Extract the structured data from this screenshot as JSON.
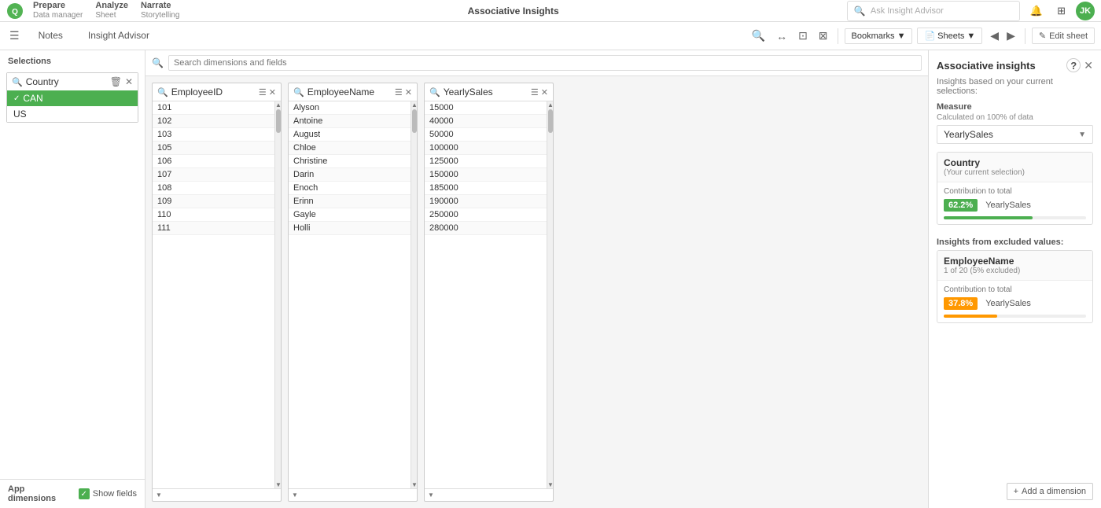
{
  "app": {
    "title": "Associative Insights",
    "tabs": [
      {
        "id": "notes",
        "label": "Notes",
        "active": false
      },
      {
        "id": "insight_advisor",
        "label": "Insight Advisor",
        "active": false
      }
    ],
    "insight_advisor_placeholder": "Ask Insight Advisor",
    "edit_sheet_label": "Edit sheet"
  },
  "toolbar": {
    "bookmarks_label": "Bookmarks",
    "sheets_label": "Sheets"
  },
  "prepare": {
    "label": "Prepare",
    "sub": "Data manager"
  },
  "analyze": {
    "label": "Analyze",
    "sub": "Sheet"
  },
  "narrate": {
    "label": "Narrate",
    "sub": "Storytelling"
  },
  "selections": {
    "header": "Selections",
    "fields": [
      {
        "id": "country",
        "title": "Country",
        "items": [
          {
            "value": "CAN",
            "state": "selected"
          },
          {
            "value": "US",
            "state": "available"
          }
        ]
      }
    ]
  },
  "app_dimensions": {
    "label": "App dimensions",
    "show_fields": "Show fields",
    "show_fields_checked": true,
    "search_placeholder": "Search dimensions and fields",
    "tables": [
      {
        "id": "employee_id",
        "title": "EmployeeID",
        "rows": [
          {
            "value": "101"
          },
          {
            "value": "102"
          },
          {
            "value": "103"
          },
          {
            "value": "105"
          },
          {
            "value": "106"
          },
          {
            "value": "107"
          },
          {
            "value": "108"
          },
          {
            "value": "109"
          },
          {
            "value": "110"
          },
          {
            "value": "111"
          }
        ]
      },
      {
        "id": "employee_name",
        "title": "EmployeeName",
        "rows": [
          {
            "value": "Alyson"
          },
          {
            "value": "Antoine"
          },
          {
            "value": "August"
          },
          {
            "value": "Chloe"
          },
          {
            "value": "Christine"
          },
          {
            "value": "Darin"
          },
          {
            "value": "Enoch"
          },
          {
            "value": "Erinn"
          },
          {
            "value": "Gayle"
          },
          {
            "value": "Holli"
          }
        ]
      },
      {
        "id": "yearly_sales",
        "title": "YearlySales",
        "rows": [
          {
            "value": "15000"
          },
          {
            "value": "40000"
          },
          {
            "value": "50000"
          },
          {
            "value": "100000"
          },
          {
            "value": "125000"
          },
          {
            "value": "150000"
          },
          {
            "value": "185000"
          },
          {
            "value": "190000"
          },
          {
            "value": "250000"
          },
          {
            "value": "280000"
          }
        ]
      }
    ]
  },
  "associative_insights": {
    "panel_title": "Associative insights",
    "help_tooltip": "Help",
    "insights_subtitle": "Insights based on your current selections:",
    "measure_label": "Measure",
    "measure_sub": "Calculated on 100% of data",
    "measure_selected": "YearlySales",
    "country_card": {
      "title": "Country",
      "subtitle": "(Your current selection)",
      "contribution_label": "Contribution to total",
      "percentage": "62.2%",
      "dimension": "YearlySales",
      "badge_color": "green"
    },
    "excluded_header": "Insights from excluded values:",
    "employee_card": {
      "title": "EmployeeName",
      "subtitle": "1 of 20 (5% excluded)",
      "contribution_label": "Contribution to total",
      "percentage": "37.8%",
      "dimension": "YearlySales",
      "badge_color": "orange"
    },
    "add_dimension_label": "Add a dimension"
  },
  "icons": {
    "search": "🔍",
    "close": "✕",
    "delete": "🗑",
    "edit": "✏",
    "check": "✓",
    "arrow_down": "▼",
    "arrow_up": "▲",
    "arrow_left": "◀",
    "arrow_right": "▶",
    "chevron_down": "⌄",
    "plus": "+",
    "help": "?",
    "menu": "☰",
    "grid": "⊞",
    "bookmark": "🔖",
    "sheet": "📄",
    "pencil": "✎",
    "hamburger": "≡"
  }
}
